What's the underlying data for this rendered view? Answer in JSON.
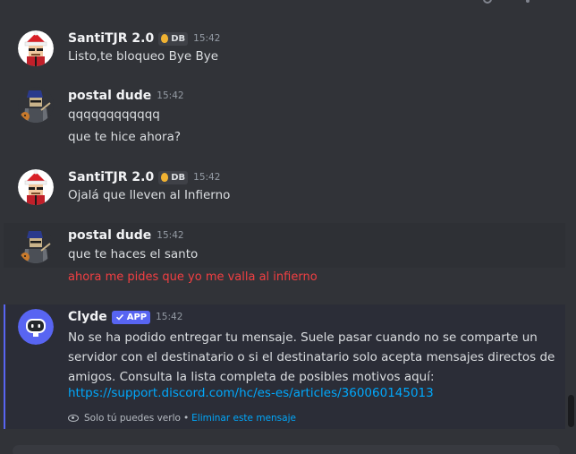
{
  "messages": [
    {
      "username": "SantiTJR 2.0",
      "tag": "DB",
      "time": "15:42",
      "lines": [
        "Listo,te bloqueo Bye Bye"
      ]
    },
    {
      "username": "postal dude",
      "time": "15:42",
      "lines": [
        "qqqqqqqqqqqq",
        "que te hice ahora?"
      ]
    },
    {
      "username": "SantiTJR 2.0",
      "tag": "DB",
      "time": "15:42",
      "lines": [
        "Ojalá que lleven al Infierno"
      ]
    },
    {
      "username": "postal dude",
      "time": "15:42",
      "lines": [
        "que te haces el santo"
      ],
      "failed_line": "ahora me pides que yo me valla al infierno"
    }
  ],
  "clyde": {
    "username": "Clyde",
    "badge": "APP",
    "time": "15:42",
    "body": "No se ha podido entregar tu mensaje. Suele pasar cuando no se comparte un servidor con el destinatario o si el destinatario solo acepta mensajes directos de amigos. Consulta la lista completa de posibles motivos aquí:",
    "link": "https://support.discord.com/hc/es-es/articles/360060145013",
    "visibility_note": "Solo tú puedes verlo",
    "separator": "•",
    "dismiss_label": "Eliminar este mensaje"
  },
  "colors": {
    "background": "#313338",
    "error_text": "#f23f42",
    "link": "#00a8fc",
    "app_badge": "#5865f2"
  },
  "icons": {
    "server_tag": "flame-icon",
    "app_badge": "checkmark-icon",
    "visibility": "eye-icon"
  }
}
